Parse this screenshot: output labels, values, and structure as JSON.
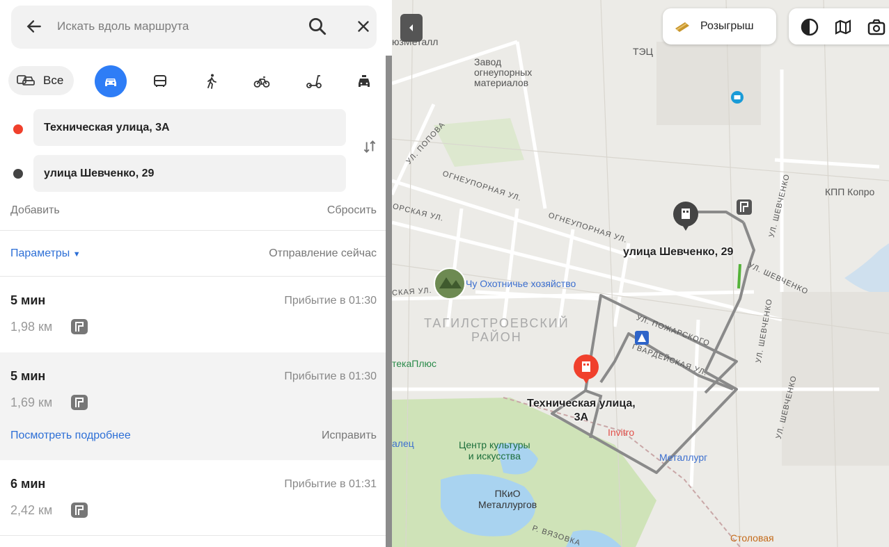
{
  "search": {
    "placeholder": "Искать вдоль маршрута"
  },
  "modes": {
    "all_label": "Все",
    "active": "car"
  },
  "points": {
    "from": "Техническая улица, 3А",
    "to": "улица Шевченко, 29",
    "add_label": "Добавить",
    "reset_label": "Сбросить"
  },
  "params": {
    "label": "Параметры",
    "departure": "Отправление сейчас"
  },
  "routes": [
    {
      "time": "5 мин",
      "arrival": "Прибытие в 01:30",
      "distance": "1,98 км"
    },
    {
      "time": "5 мин",
      "arrival": "Прибытие в 01:30",
      "distance": "1,69 км",
      "details_label": "Посмотреть подробнее",
      "fix_label": "Исправить"
    },
    {
      "time": "6 мин",
      "arrival": "Прибытие в 01:31",
      "distance": "2,42 км"
    }
  ],
  "map": {
    "promo_label": "Розыгрыш",
    "labels": {
      "soyuzmetall": "юзМеталл",
      "zavod": "Завод\nогнеупорных\nматериалов",
      "tec": "ТЭЦ",
      "kpp": "КПП Копро",
      "district": "ТАГИЛСТРОЕВСКИЙ\nРАЙОН",
      "hunting": "Чу Охотничье хозяйство",
      "aptekaplus": "текаПлюс",
      "palace": "алец",
      "culture": "Центр культуры\nи искусства",
      "park": "ПКиО\nМеталлургов",
      "invitro": "Invitro",
      "metallurg": "Металлург",
      "stolovaya": "Столовая",
      "dest_label": "улица Шевченко, 29",
      "origin_label": "Техническая улица,\n3А"
    },
    "streets": {
      "popova": "УЛ. ПОПОВА",
      "ogneupornaya1": "ОГНЕУПОРНАЯ УЛ.",
      "ogneupornaya2": "ОГНЕУПОРНАЯ УЛ.",
      "pozharskogo": "УЛ. ПОЖАРСКОГО",
      "gvardeyskaya": "ГВАРДЕЙСКАЯ УЛ.",
      "shevchenko1": "УЛ. ШЕВЧЕНКО",
      "shevchenko2": "УЛ. ШЕВЧЕНКО",
      "shevchenko3": "УЛ. ШЕВЧЕНКО",
      "shevchenko4": "УЛ. ШЕВЧЕНКО",
      "orskaya": "ОРСКАЯ УЛ.",
      "ekaya": "СКАЯ УЛ.",
      "vyazovka": "Р. ВЯЗОВКА"
    }
  },
  "colors": {
    "accent": "#2e7df6",
    "origin": "#f0402c",
    "destination": "#444444"
  }
}
